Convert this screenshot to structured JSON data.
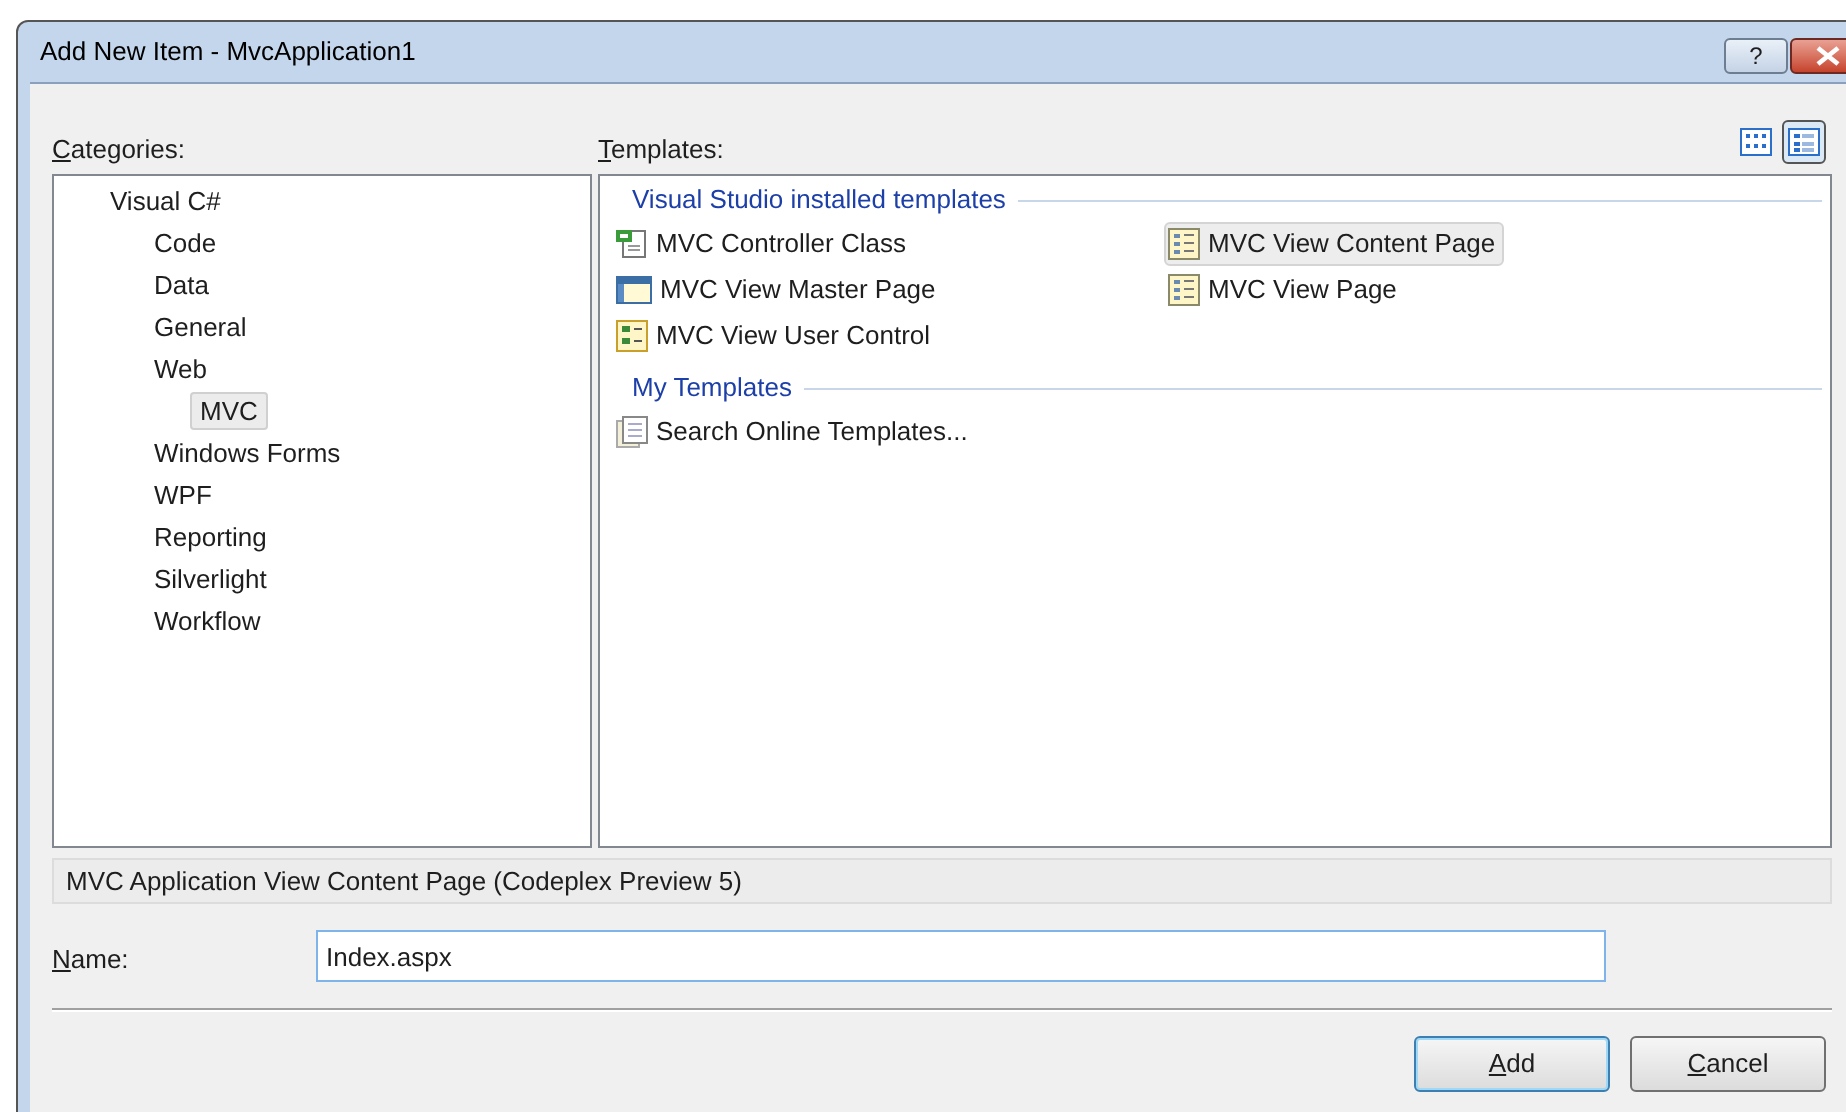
{
  "window": {
    "title": "Add New Item - MvcApplication1",
    "help_button": "?"
  },
  "categories": {
    "label": "Categories:",
    "items": [
      {
        "label": "Visual C#",
        "selected": false,
        "children": [
          {
            "label": "Code",
            "selected": false
          },
          {
            "label": "Data",
            "selected": false
          },
          {
            "label": "General",
            "selected": false
          },
          {
            "label": "Web",
            "selected": false,
            "children": [
              {
                "label": "MVC",
                "selected": true
              }
            ]
          },
          {
            "label": "Windows Forms",
            "selected": false
          },
          {
            "label": "WPF",
            "selected": false
          },
          {
            "label": "Reporting",
            "selected": false
          },
          {
            "label": "Silverlight",
            "selected": false
          },
          {
            "label": "Workflow",
            "selected": false
          }
        ]
      }
    ]
  },
  "templates": {
    "label": "Templates:",
    "view_modes": [
      {
        "kind": "large",
        "selected": false
      },
      {
        "kind": "small",
        "selected": true
      }
    ],
    "groups": [
      {
        "title": "Visual Studio installed templates",
        "items": [
          {
            "label": "MVC Controller Class",
            "kind": "class",
            "selected": false
          },
          {
            "label": "MVC View Master Page",
            "kind": "master",
            "selected": false
          },
          {
            "label": "MVC View User Control",
            "kind": "control",
            "selected": false
          },
          {
            "label": "MVC View Content Page",
            "kind": "page",
            "selected": true
          },
          {
            "label": "MVC View Page",
            "kind": "page",
            "selected": false
          }
        ]
      },
      {
        "title": "My Templates",
        "items": [
          {
            "label": "Search Online Templates...",
            "kind": "search",
            "selected": false
          }
        ]
      }
    ]
  },
  "description": "MVC Application View Content Page (Codeplex Preview 5)",
  "name_field": {
    "label": "Name:",
    "value": "Index.aspx"
  },
  "buttons": [
    {
      "label": "Add",
      "default": true
    },
    {
      "label": "Cancel",
      "default": false
    }
  ]
}
